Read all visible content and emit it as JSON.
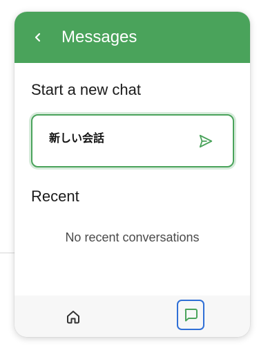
{
  "header": {
    "title": "Messages",
    "back_icon": "chevron-left-icon"
  },
  "new_chat": {
    "section_title": "Start a new chat",
    "input_value": "新しい会話",
    "send_icon": "send-icon"
  },
  "recent": {
    "section_title": "Recent",
    "empty_text": "No recent conversations"
  },
  "bottom_nav": {
    "items": [
      {
        "icon": "home-icon",
        "active": false
      },
      {
        "icon": "chat-bubble-icon",
        "active": true
      }
    ]
  },
  "colors": {
    "accent": "#4aa35b",
    "focus_ring": "#2f6fd6",
    "header_text": "#ffffff"
  }
}
